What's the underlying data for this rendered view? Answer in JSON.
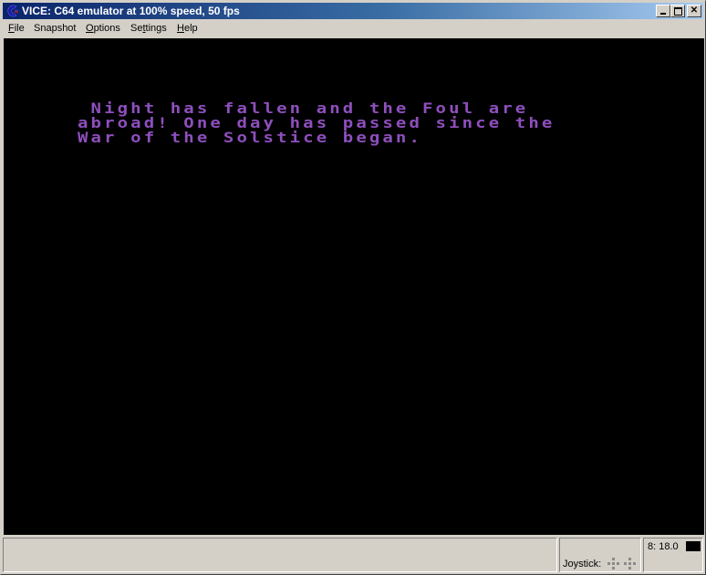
{
  "window": {
    "title": "VICE: C64 emulator at 100% speed, 50 fps",
    "icon": "vice-c64-icon",
    "controls": [
      "minimize",
      "maximize",
      "close"
    ]
  },
  "menubar": {
    "items": [
      {
        "label": "File",
        "accel": "F"
      },
      {
        "label": "Snapshot",
        "accel": ""
      },
      {
        "label": "Options",
        "accel": "O"
      },
      {
        "label": "Settings",
        "accel": "t"
      },
      {
        "label": "Help",
        "accel": "H"
      }
    ]
  },
  "screen": {
    "background": "#000000",
    "text_color": "#8e4fbd",
    "lines": [
      " Night has fallen and the Foul are",
      "abroad! One day has passed since the",
      "War of the Solstice began."
    ]
  },
  "statusbar": {
    "message": "",
    "joystick_label": "Joystick:",
    "drive_status": "8: 18.0",
    "drive_led_color": "#000000"
  }
}
